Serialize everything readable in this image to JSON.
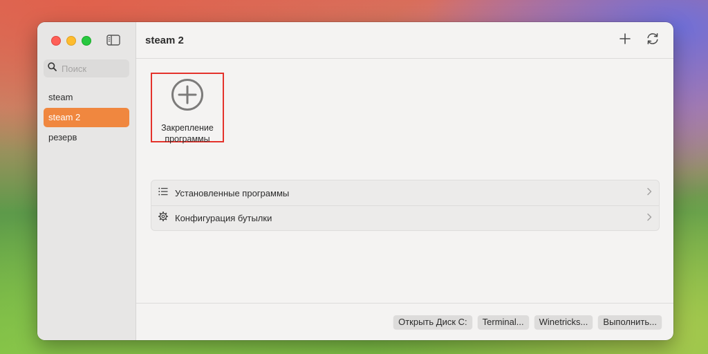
{
  "colors": {
    "accent": "#f0873f",
    "highlight_border": "#e4322b"
  },
  "sidebar": {
    "search_placeholder": "Поиск",
    "bottles": [
      {
        "label": "steam",
        "selected": false
      },
      {
        "label": "steam 2",
        "selected": true
      },
      {
        "label": "резерв",
        "selected": false
      }
    ]
  },
  "header": {
    "title": "steam 2",
    "icons": [
      "plus-icon",
      "refresh-icon"
    ]
  },
  "pin": {
    "label_line1": "Закрепление",
    "label_line2": "программы",
    "icon": "plus-circle-icon"
  },
  "list": {
    "items": [
      {
        "label": "Установленные программы",
        "icon": "list-icon"
      },
      {
        "label": "Конфигурация бутылки",
        "icon": "gear-icon"
      }
    ]
  },
  "footer": {
    "buttons": [
      "Открыть Диск С:",
      "Terminal...",
      "Winetricks...",
      "Выполнить..."
    ]
  }
}
